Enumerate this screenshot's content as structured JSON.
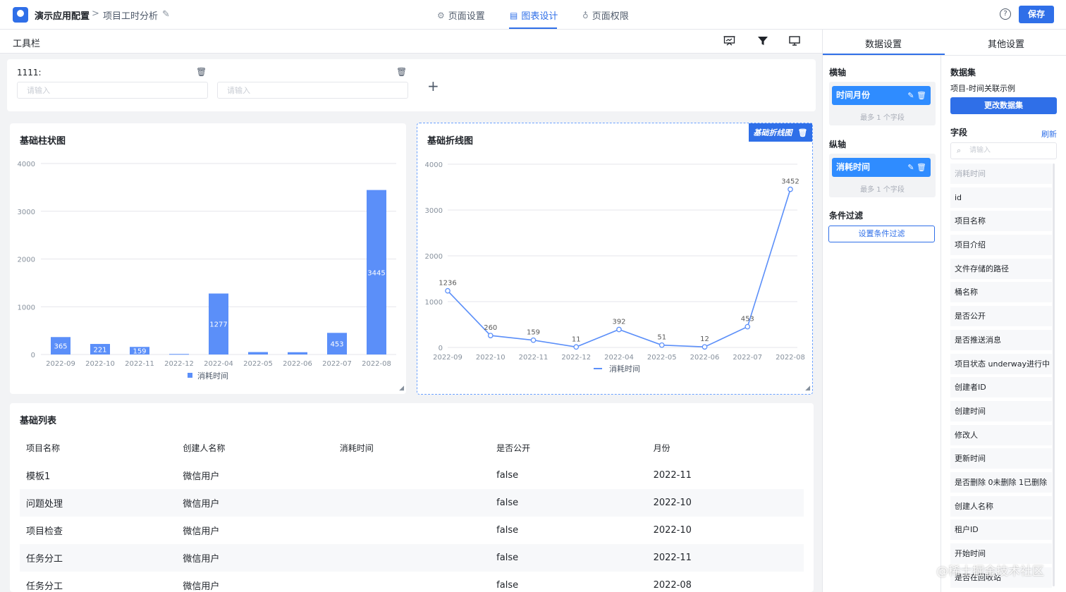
{
  "header": {
    "app_name": "演示应用配置",
    "crumb_sep": ">",
    "page_name": "项目工时分析",
    "tabs": [
      {
        "label": "页面设置",
        "icon": "gear-icon"
      },
      {
        "label": "图表设计",
        "icon": "chart-icon"
      },
      {
        "label": "页面权限",
        "icon": "permission-icon"
      }
    ],
    "active_tab": "图表设计",
    "help": "?",
    "save_label": "保存"
  },
  "toolbar": {
    "title": "工具栏",
    "icons": [
      "presentation-icon",
      "funnel-icon",
      "monitor-icon"
    ]
  },
  "filter": {
    "label": "1111:",
    "inputs": [
      {
        "placeholder": "请输入"
      },
      {
        "placeholder": "请输入"
      }
    ],
    "add": "+"
  },
  "bar_chart": {
    "title": "基础柱状图",
    "chart_data": {
      "type": "bar",
      "categories": [
        "2022-09",
        "2022-10",
        "2022-11",
        "2022-12",
        "2022-04",
        "2022-05",
        "2022-06",
        "2022-07",
        "2022-08"
      ],
      "series": [
        {
          "name": "消耗时间",
          "values": [
            365,
            221,
            159,
            11,
            1277,
            51,
            48,
            453,
            3445
          ]
        }
      ],
      "ylim": [
        0,
        4000
      ],
      "yticks": [
        0,
        1000,
        2000,
        3000,
        4000
      ],
      "grid": true,
      "legend": "bottom",
      "color": "#5b8ff9"
    }
  },
  "line_chart": {
    "title": "基础折线图",
    "tag": "基础折线图",
    "chart_data": {
      "type": "line",
      "categories": [
        "2022-09",
        "2022-10",
        "2022-11",
        "2022-12",
        "2022-04",
        "2022-05",
        "2022-06",
        "2022-07",
        "2022-08"
      ],
      "series": [
        {
          "name": "消耗时间",
          "values": [
            1236,
            260,
            159,
            11,
            392,
            51,
            12,
            453,
            3452
          ]
        }
      ],
      "ylim": [
        0,
        4000
      ],
      "yticks": [
        0,
        1000,
        2000,
        3000,
        4000
      ],
      "grid": true,
      "legend": "bottom",
      "color": "#5b8ff9"
    }
  },
  "list": {
    "title": "基础列表",
    "columns": [
      "项目名称",
      "创建人名称",
      "消耗时间",
      "是否公开",
      "月份"
    ],
    "rows": [
      [
        "模板1",
        "微信用户",
        "",
        "false",
        "2022-11"
      ],
      [
        "问题处理",
        "微信用户",
        "",
        "false",
        "2022-10"
      ],
      [
        "项目检查",
        "微信用户",
        "",
        "false",
        "2022-10"
      ],
      [
        "任务分工",
        "微信用户",
        "",
        "false",
        "2022-11"
      ],
      [
        "任务分工",
        "微信用户",
        "",
        "false",
        "2022-08"
      ]
    ]
  },
  "right_panel": {
    "tabs": [
      "数据设置",
      "其他设置"
    ],
    "x_axis": {
      "title": "横轴",
      "field": "时间月份",
      "hint": "最多 1 个字段"
    },
    "y_axis": {
      "title": "纵轴",
      "field": "消耗时间",
      "hint": "最多 1 个字段"
    },
    "condition": {
      "title": "条件过滤",
      "button": "设置条件过滤"
    },
    "dataset": {
      "title": "数据集",
      "name": "项目-时间关联示例",
      "button": "更改数据集"
    },
    "fields": {
      "title": "字段",
      "refresh": "刷新",
      "search_placeholder": "请输入",
      "items": [
        "消耗时间",
        "id",
        "项目名称",
        "项目介绍",
        "文件存储的路径",
        "桶名称",
        "是否公开",
        "是否推送消息",
        "项目状态 underway进行中",
        "创建者ID",
        "创建时间",
        "修改人",
        "更新时间",
        "是否删除 0未删除 1已删除",
        "创建人名称",
        "租户ID",
        "开始时间",
        "是否在回收站"
      ]
    }
  },
  "watermark": "@稀土掘金技术社区"
}
